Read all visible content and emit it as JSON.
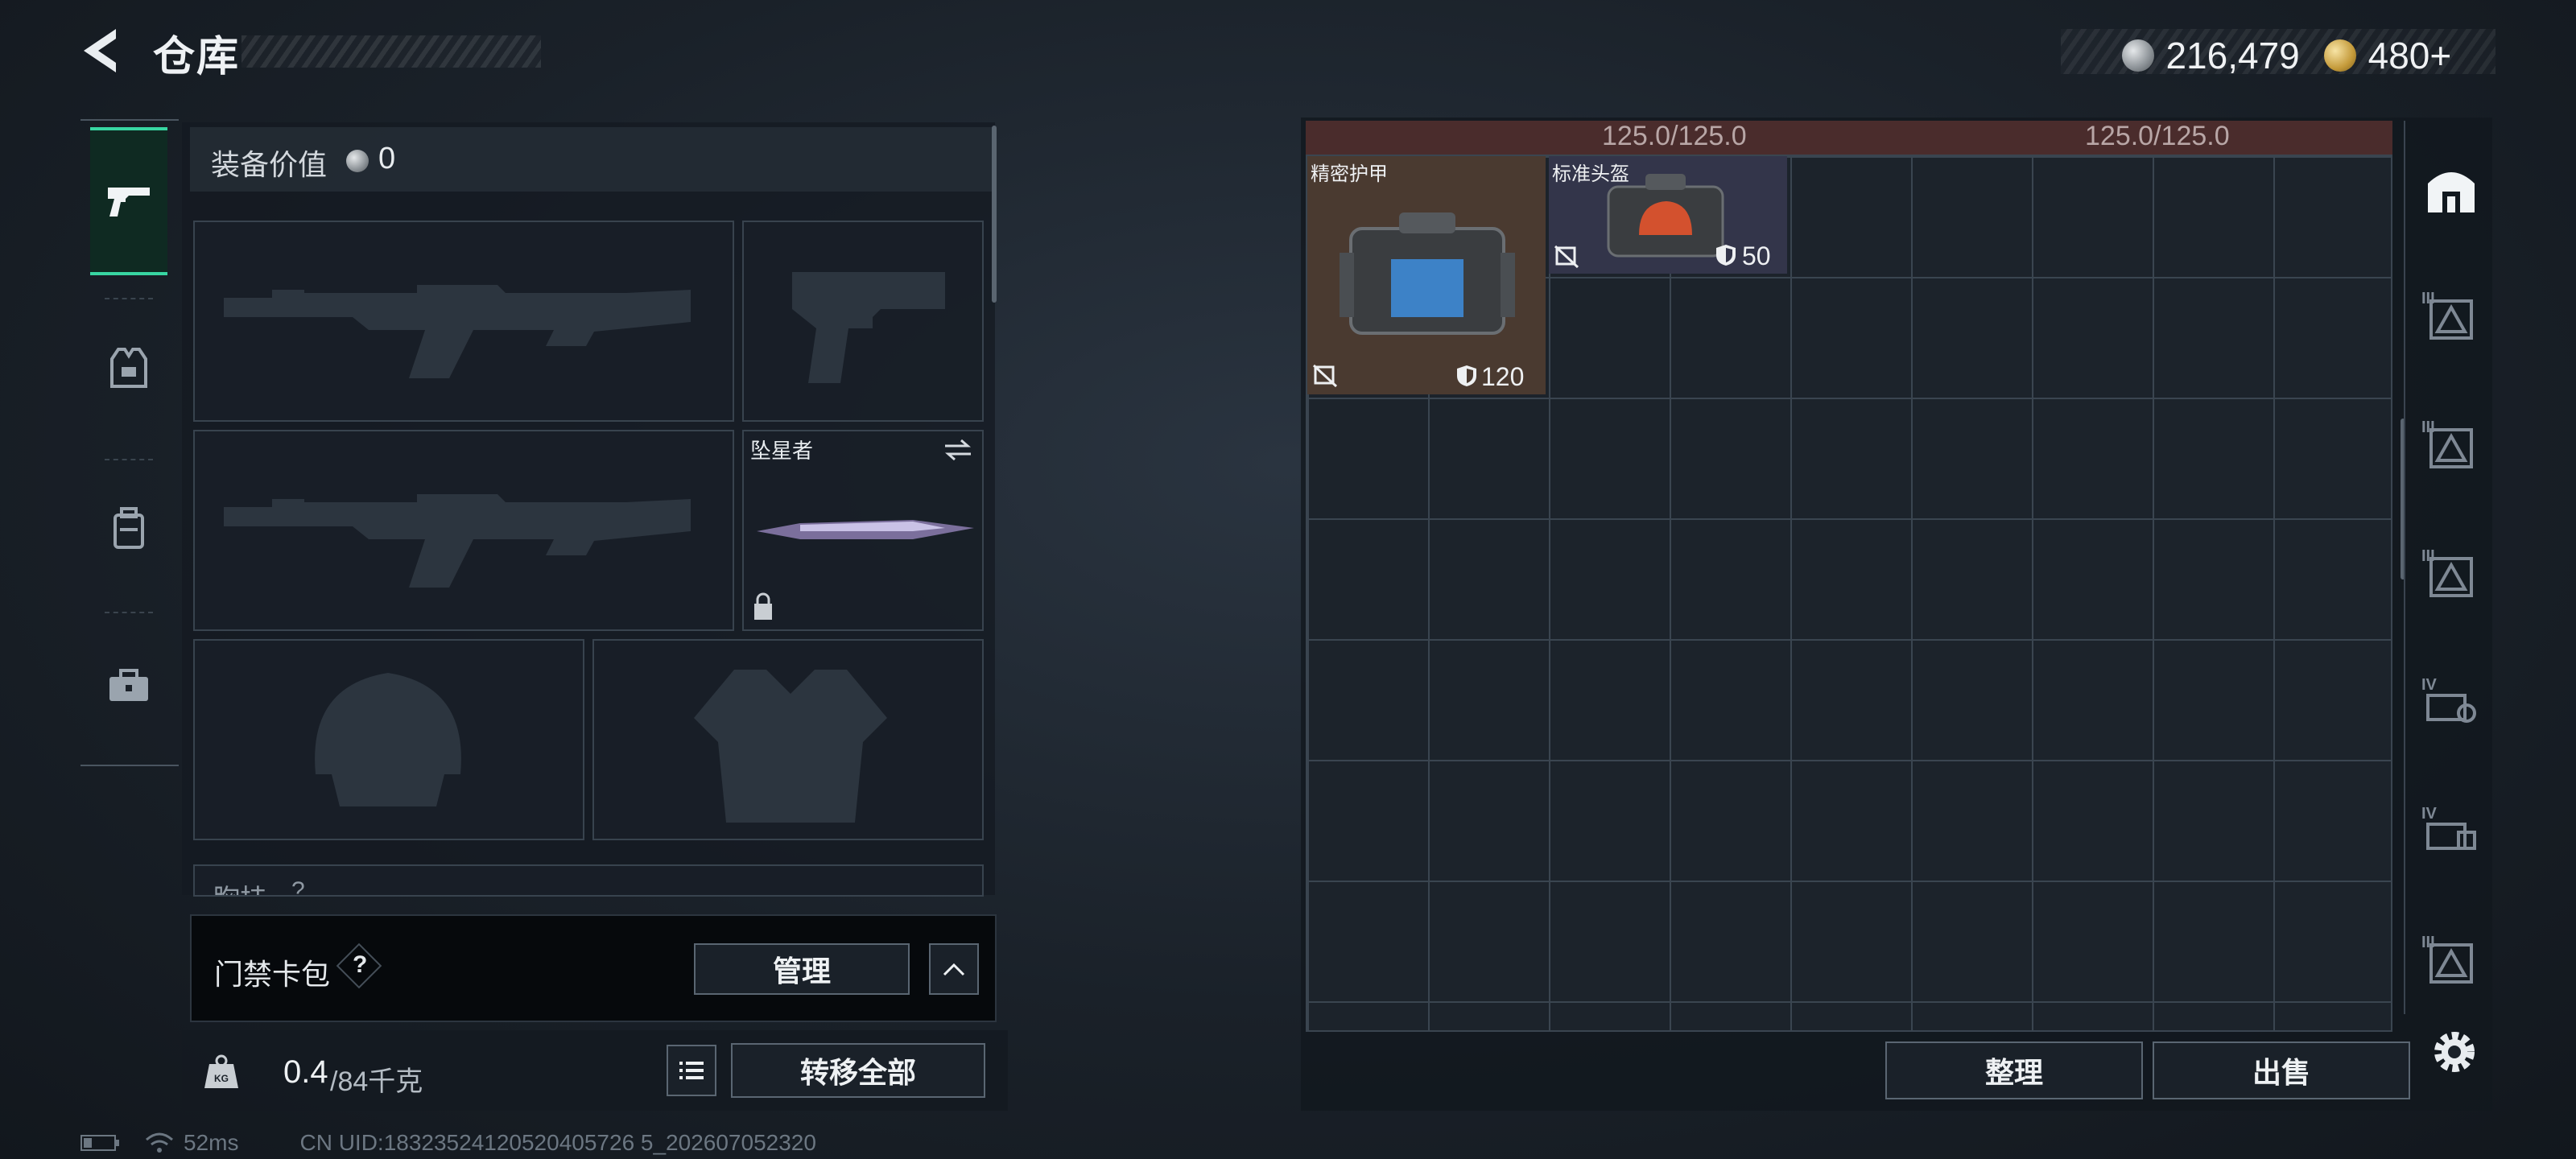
{
  "header": {
    "title": "仓库"
  },
  "currency": {
    "silver": "216,479",
    "gold": "480+"
  },
  "nav": {
    "items": [
      "weapon",
      "armor",
      "backpack",
      "toolbox"
    ]
  },
  "equipment": {
    "value_label": "装备价值",
    "value": "0",
    "melee_name": "坠星者",
    "chest_rig_label": "胸挂",
    "chest_rig_value": "?"
  },
  "card_bag": {
    "label": "门禁卡包",
    "help": "?",
    "manage_label": "管理"
  },
  "weight": {
    "current": "0.4",
    "max": "/84千克",
    "icon_text": "KG"
  },
  "transfer_all_label": "转移全部",
  "warehouse": {
    "capacity_left": "125.0/125.0",
    "capacity_right": "125.0/125.0",
    "items": [
      {
        "name": "精密护甲",
        "durability": "120"
      },
      {
        "name": "标准头盔",
        "durability": "50"
      }
    ],
    "tabs": [
      "III",
      "III",
      "III",
      "IV",
      "IV",
      "III"
    ],
    "sort_label": "整理",
    "sell_label": "出售"
  },
  "status": {
    "ping": "52ms",
    "uid": "CN UID:18323524120520405726 5_202607052320"
  },
  "colors": {
    "accent": "#38d6a2",
    "capacity_bg": "#4a2c2c"
  }
}
